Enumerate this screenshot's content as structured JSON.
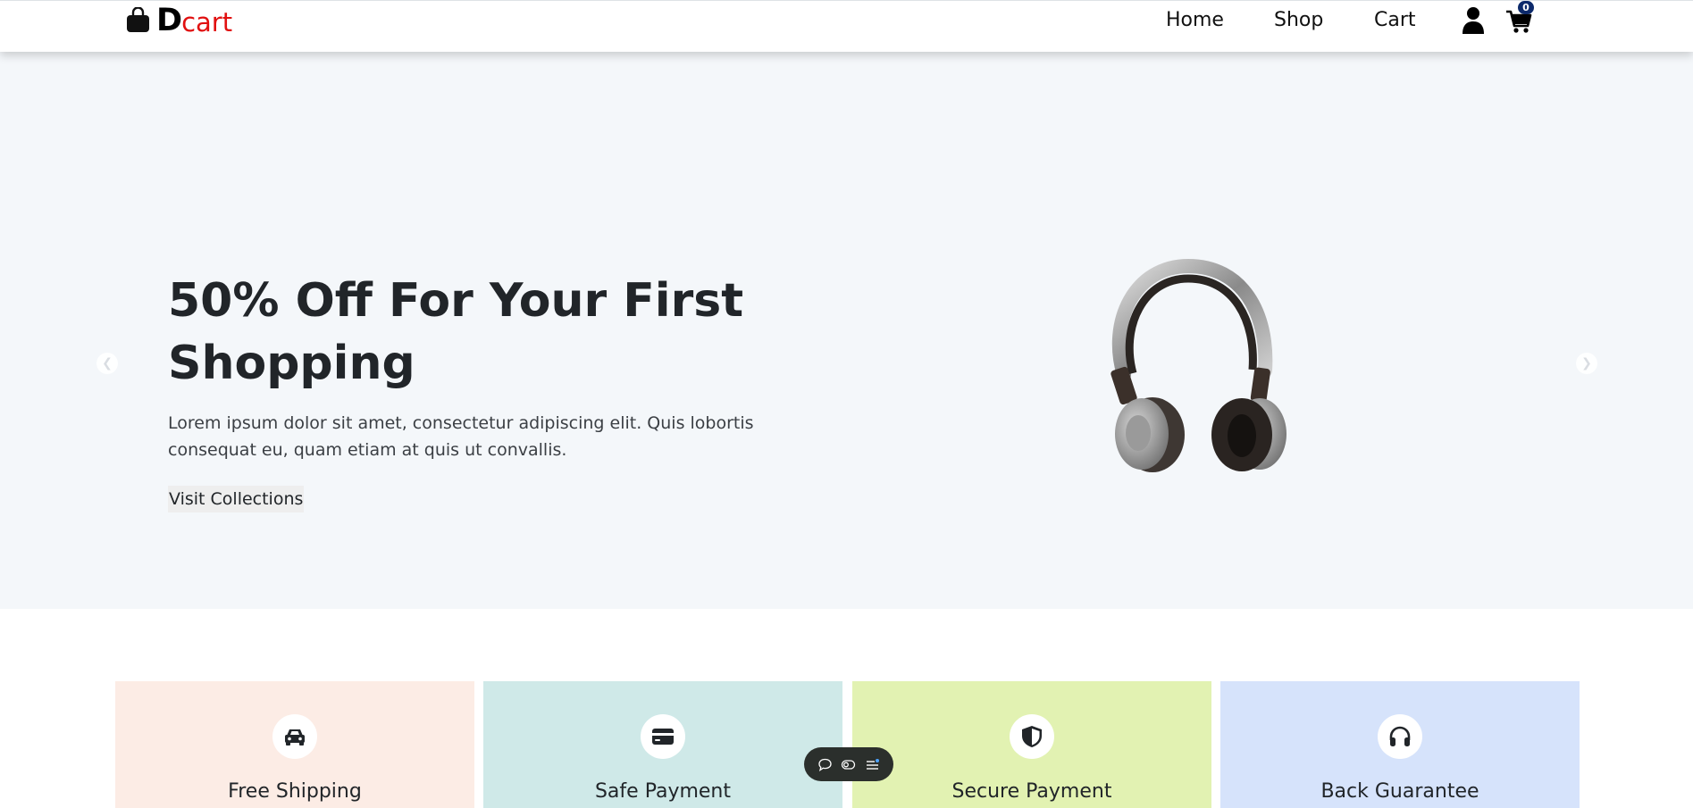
{
  "navbar": {
    "brand_d": "D",
    "brand_rest": "cart",
    "links": [
      "Home",
      "Shop",
      "Cart"
    ],
    "cart_count": "0",
    "icons": [
      "shopping-bag-icon",
      "user-icon",
      "cart-icon"
    ]
  },
  "hero": {
    "title": "50% Off For Your First Shopping",
    "text": "Lorem ipsum dolor sit amet, consectetur adipiscing elit. Quis lobortis consequat eu, quam etiam at quis ut convallis.",
    "button_label": "Visit Collections",
    "prev_icon": "chevron-left-icon",
    "next_icon": "chevron-right-icon",
    "image": "headphones"
  },
  "features": [
    {
      "label": "Free Shipping",
      "icon": "car-icon",
      "bg": "#fcece5"
    },
    {
      "label": "Safe Payment",
      "icon": "credit-card-icon",
      "bg": "#cfe9e8"
    },
    {
      "label": "Secure Payment",
      "icon": "shield-icon",
      "bg": "#e2f2b2"
    },
    {
      "label": "Back Guarantee",
      "icon": "headphones-icon",
      "bg": "#d6e3fb"
    }
  ],
  "colors": {
    "brand_red": "#e11010",
    "badge": "#0d2a6b",
    "hero_bg": "#f4f7fa",
    "toolbar_bg": "#2b2f2c"
  },
  "floating_toolbar": {
    "icons": [
      "comment-icon",
      "toggle-icon",
      "list-icon"
    ]
  }
}
